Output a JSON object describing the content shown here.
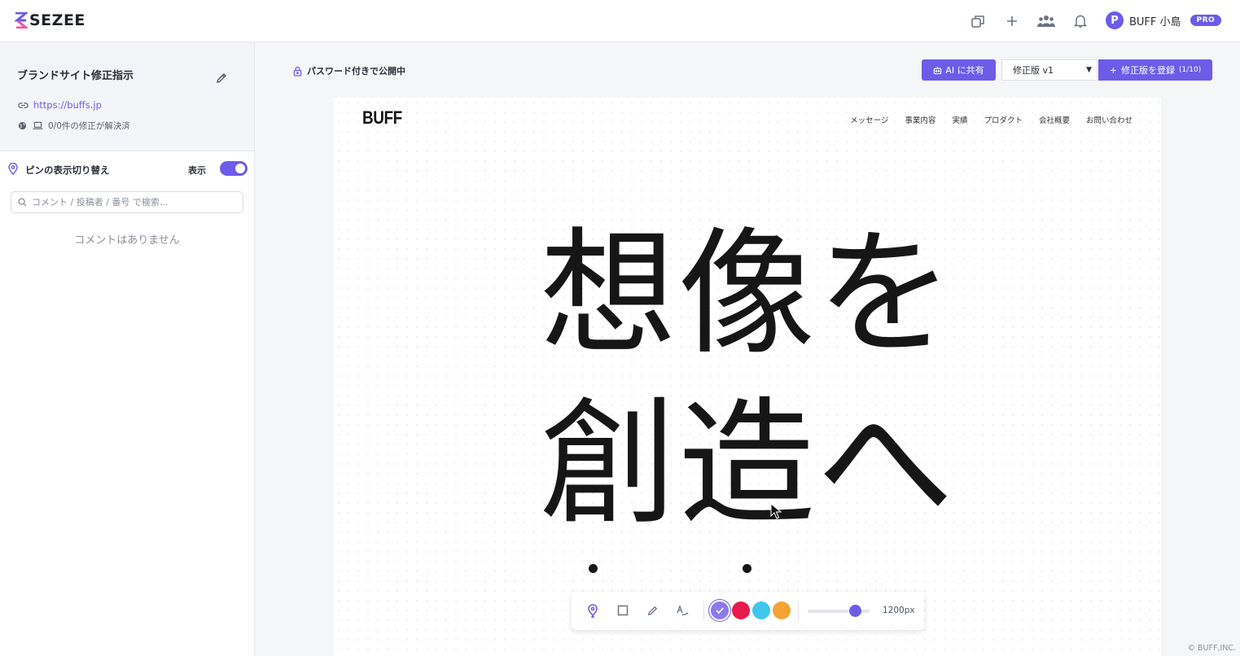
{
  "app": {
    "logo_text": "SEZEE",
    "icons": [
      "windows-icon",
      "plus-icon",
      "team-icon",
      "bell-icon"
    ],
    "user": {
      "avatar_initial": "P",
      "name": "BUFF 小島",
      "plan_badge": "PRO"
    },
    "colors": {
      "accent": "#6c5ce7",
      "red": "#e8194b",
      "cyan": "#3ec6ee",
      "orange": "#f4a233"
    }
  },
  "sidebar": {
    "project_title": "ブランドサイト修正指示",
    "url": "https://buffs.jp",
    "status": "0/0件の修正が解決済",
    "pin_toggle_label": "ピンの表示切り替え",
    "pin_show_label": "表示",
    "pins_visible": true,
    "search_placeholder": "コメント / 投稿者 / 番号 で検索...",
    "empty_comments": "コメントはありません"
  },
  "main": {
    "publish_status": "パスワード付きで公開中",
    "ai_share_label": "AI に共有",
    "version_selected": "修正版 v1",
    "register_label": "修正版を登録",
    "register_count": "(1/10)"
  },
  "preview": {
    "site_logo": "BUFF",
    "nav": [
      "メッセージ",
      "事業内容",
      "実績",
      "プロダクト",
      "会社概要",
      "お問い合わせ"
    ],
    "hero_line1": "想像を",
    "hero_line2": "創造へ"
  },
  "toolbar": {
    "tools": [
      "pin-tool",
      "rectangle-tool",
      "pencil-tool",
      "text-tool"
    ],
    "active_tool": "pin-tool",
    "swatches": [
      "#8b79ee",
      "#e8194b",
      "#3ec6ee",
      "#f4a233"
    ],
    "selected_swatch": 0,
    "width_value": 0.8,
    "width_label": "1200px"
  },
  "footer": {
    "copyright": "© BUFF,INC."
  }
}
